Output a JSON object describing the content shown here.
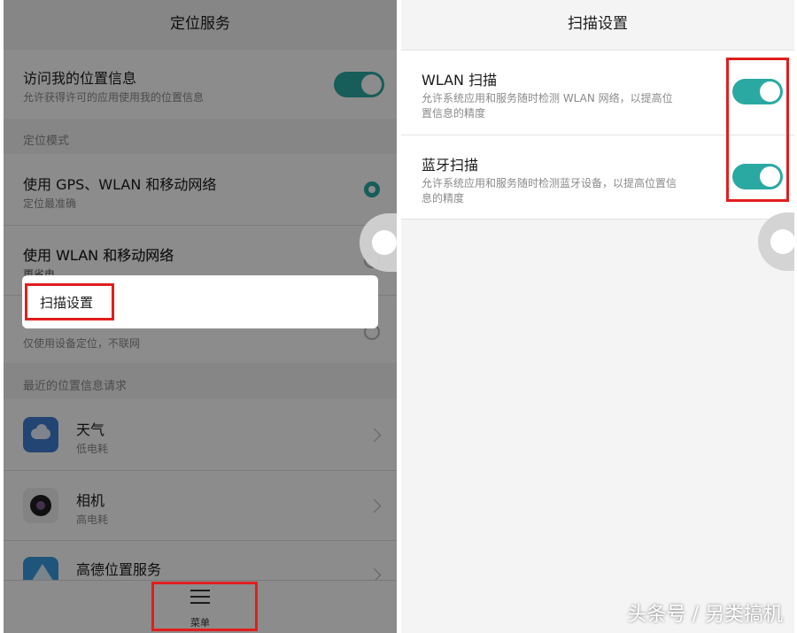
{
  "left_screen": {
    "title": "定位服务",
    "location_access": {
      "label": "访问我的位置信息",
      "desc": "允许获得许可的应用使用我的位置信息",
      "enabled": true
    },
    "mode_section_label": "定位模式",
    "modes": [
      {
        "label": "使用 GPS、WLAN 和移动网络",
        "desc": "定位最准确",
        "selected": true
      },
      {
        "label": "使用 WLAN 和移动网络",
        "desc": "更省电",
        "selected": false
      },
      {
        "label": "",
        "desc": "仅使用设备定位，不联网",
        "selected": false
      }
    ],
    "recent_section_label": "最近的位置信息请求",
    "apps": [
      {
        "name": "天气",
        "desc": "低电耗",
        "icon": "weather-icon"
      },
      {
        "name": "相机",
        "desc": "高电耗",
        "icon": "camera-icon"
      },
      {
        "name": "高德位置服务",
        "desc": "",
        "icon": "amap-icon"
      }
    ],
    "popup_menu": {
      "item": "扫描设置"
    },
    "bottom_menu_label": "菜单"
  },
  "right_screen": {
    "title": "扫描设置",
    "settings": [
      {
        "label": "WLAN 扫描",
        "desc_line1": "允许系统应用和服务随时检测 WLAN 网络，以提高位",
        "desc_line2": "置信息的精度",
        "enabled": true
      },
      {
        "label": "蓝牙扫描",
        "desc_line1": "允许系统应用和服务随时检测蓝牙设备，以提高位置信",
        "desc_line2": "息的精度",
        "enabled": true
      }
    ]
  },
  "watermark": "头条号 / 另类搞机",
  "colors": {
    "accent": "#2aa9a3",
    "highlight_box": "#e01e1e",
    "background": "#f4f4f4"
  }
}
